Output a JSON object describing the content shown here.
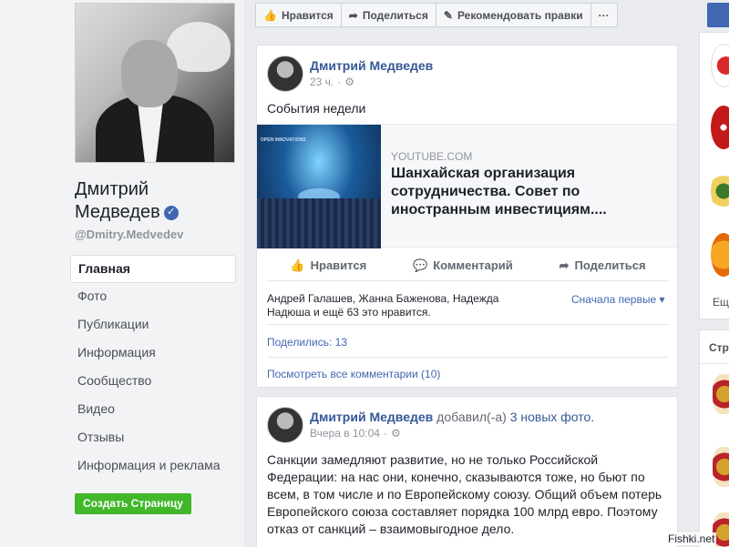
{
  "toolbar": {
    "like": "Нравится",
    "share": "Поделиться",
    "recommend": "Рекомендовать правки",
    "more": "···"
  },
  "page": {
    "name": "Дмитрий Медведев",
    "username": "@Dmitry.Medvedev"
  },
  "sidebar": {
    "items": [
      {
        "label": "Главная"
      },
      {
        "label": "Фото"
      },
      {
        "label": "Публикации"
      },
      {
        "label": "Информация"
      },
      {
        "label": "Сообщество"
      },
      {
        "label": "Видео"
      },
      {
        "label": "Отзывы"
      },
      {
        "label": "Информация и реклама"
      }
    ],
    "create_page": "Создать Страницу"
  },
  "post1": {
    "author": "Дмитрий Медведев",
    "time": "23 ч.",
    "text": "События недели",
    "link": {
      "source": "YOUTUBE.COM",
      "title": "Шанхайская организация сотрудничества. Совет по иностранным инвестициям....",
      "thumb_caption": "OPEN INNOVATIONS"
    },
    "actions": {
      "like": "Нравится",
      "comment": "Комментарий",
      "share": "Поделиться"
    },
    "reactions": "Андрей Галашев, Жанна Баженова, Надежда Надюша и ещё 63 это нравится.",
    "sort": "Сначала первые",
    "shares": "Поделились: 13",
    "comments": "Посмотреть все комментарии (10)"
  },
  "post2": {
    "author": "Дмитрий Медведев",
    "added": "добавил(-а)",
    "photos_link": "3 новых фото.",
    "time": "Вчера в 10:04",
    "text": "Санкции замедляют развитие, но не только Российской Федерации: на нас они, конечно, сказываются тоже, но бьют по всем, в том числе и по Европейскому союзу. Общий объем потерь Европейского союза составляет порядка 100 млрд евро. Поэтому отказ от санкций – взаимовыгодное дело."
  },
  "right": {
    "more": "Ещ",
    "section_title": "Стр"
  },
  "watermark": "Fishki.net"
}
